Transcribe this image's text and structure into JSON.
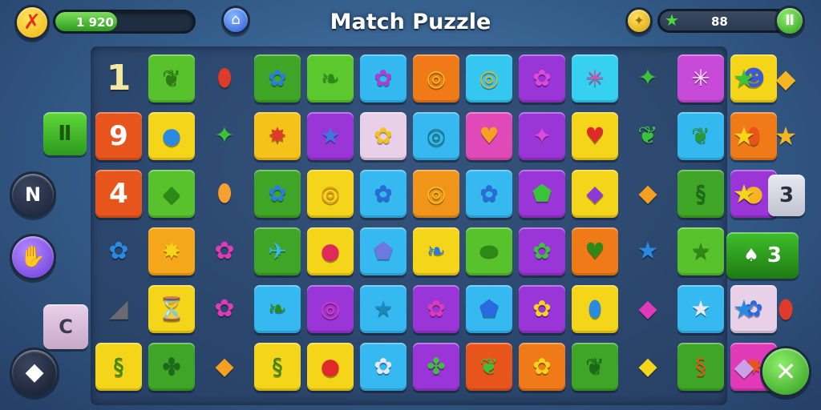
{
  "header": {
    "title": "Match Puzzle",
    "score_value": "1 920",
    "moves_value": "88",
    "progress_fraction": 0.45,
    "moves_fraction": 0.93
  },
  "side_left": {
    "pause_glyph": "Ⅱ",
    "n_glyph": "N",
    "c_glyph": "C"
  },
  "side_right": {
    "three_value": "3",
    "mixed_label": "3"
  },
  "board": {
    "rows": [
      [
        {
          "kind": "plain",
          "glyph": "1",
          "fg": "#f4e7a0"
        },
        {
          "kind": "tile",
          "bg": "#57c22b",
          "glyph": "❦",
          "fg": "#2d7a12"
        },
        {
          "kind": "plain",
          "glyph": "⬮",
          "fg": "#e03a2a"
        },
        {
          "kind": "tile",
          "bg": "#3ea526",
          "glyph": "✿",
          "fg": "#2a7de0"
        },
        {
          "kind": "tile",
          "bg": "#5bc92e",
          "glyph": "❧",
          "fg": "#2a8a16"
        },
        {
          "kind": "tile",
          "bg": "#33b9f0",
          "glyph": "✿",
          "fg": "#b23ad8"
        },
        {
          "kind": "tile",
          "bg": "#f07a18",
          "glyph": "◎",
          "fg": "#f5c020"
        },
        {
          "kind": "tile",
          "bg": "#36c7f0",
          "glyph": "◎",
          "fg": "#e8b520"
        },
        {
          "kind": "tile",
          "bg": "#9a36d8",
          "glyph": "✿",
          "fg": "#e04ad8"
        },
        {
          "kind": "tile",
          "bg": "#36d0f0",
          "glyph": "✳",
          "fg": "#e04aa8"
        },
        {
          "kind": "plain",
          "glyph": "✦",
          "fg": "#3bc23a"
        },
        {
          "kind": "tile",
          "bg": "#c84ad8",
          "glyph": "✳",
          "fg": "#f8e0f8"
        },
        {
          "kind": "tile",
          "bg": "#f5d51a",
          "glyph": "☻",
          "fg": "#3a5ad8"
        }
      ],
      [
        {
          "kind": "tile",
          "bg": "#e8551c",
          "glyph": "9",
          "fg": "#ffffff",
          "num": true
        },
        {
          "kind": "tile",
          "bg": "#f5d51a",
          "glyph": "●",
          "fg": "#2a8ae0"
        },
        {
          "kind": "plain",
          "glyph": "✦",
          "fg": "#3bc23a"
        },
        {
          "kind": "tile",
          "bg": "#f5c21a",
          "glyph": "✸",
          "fg": "#e03a2a"
        },
        {
          "kind": "tile",
          "bg": "#9a36d8",
          "glyph": "★",
          "fg": "#3a7ae0"
        },
        {
          "kind": "tile",
          "bg": "#e8d0e8",
          "glyph": "✿",
          "fg": "#f5c21a"
        },
        {
          "kind": "tile",
          "bg": "#36b9f0",
          "glyph": "◎",
          "fg": "#1a7a8a"
        },
        {
          "kind": "tile",
          "bg": "#e04ab8",
          "glyph": "♥",
          "fg": "#f5a020"
        },
        {
          "kind": "tile",
          "bg": "#9a36d8",
          "glyph": "✦",
          "fg": "#e04ad8"
        },
        {
          "kind": "tile",
          "bg": "#f5d51a",
          "glyph": "♥",
          "fg": "#e02a2a"
        },
        {
          "kind": "plain",
          "glyph": "❦",
          "fg": "#3bc23a"
        },
        {
          "kind": "tile",
          "bg": "#33b9f0",
          "glyph": "❦",
          "fg": "#2a9a2a"
        },
        {
          "kind": "tile",
          "bg": "#f07a18",
          "glyph": "⬮",
          "fg": "#e8551c"
        }
      ],
      [
        {
          "kind": "tile",
          "bg": "#e8551c",
          "glyph": "4",
          "fg": "#ffffff",
          "num": true
        },
        {
          "kind": "tile",
          "bg": "#57c22b",
          "glyph": "◆",
          "fg": "#2d8a16"
        },
        {
          "kind": "plain",
          "glyph": "⬮",
          "fg": "#f5a030"
        },
        {
          "kind": "tile",
          "bg": "#3ea526",
          "glyph": "✿",
          "fg": "#2a7de0"
        },
        {
          "kind": "tile",
          "bg": "#f5d51a",
          "glyph": "◎",
          "fg": "#e8951a"
        },
        {
          "kind": "tile",
          "bg": "#36b9f0",
          "glyph": "✿",
          "fg": "#2a6ae0"
        },
        {
          "kind": "tile",
          "bg": "#f0951a",
          "glyph": "◎",
          "fg": "#f5c020"
        },
        {
          "kind": "tile",
          "bg": "#36b9f0",
          "glyph": "✿",
          "fg": "#2a6ae0"
        },
        {
          "kind": "tile",
          "bg": "#9a36d8",
          "glyph": "⬟",
          "fg": "#3bc23a"
        },
        {
          "kind": "tile",
          "bg": "#f5d51a",
          "glyph": "◆",
          "fg": "#8a3ad8"
        },
        {
          "kind": "plain",
          "glyph": "◆",
          "fg": "#f5a020"
        },
        {
          "kind": "tile",
          "bg": "#3ea526",
          "glyph": "§",
          "fg": "#1a6a1a"
        },
        {
          "kind": "tile",
          "bg": "#9a36d8",
          "glyph": "●",
          "fg": "#f5b520"
        }
      ],
      [
        {
          "kind": "plain",
          "glyph": "✿",
          "fg": "#2a8ae0"
        },
        {
          "kind": "tile",
          "bg": "#f5a61a",
          "glyph": "✸",
          "fg": "#f5d51a"
        },
        {
          "kind": "plain",
          "glyph": "✿",
          "fg": "#e03ab8"
        },
        {
          "kind": "tile",
          "bg": "#3ea526",
          "glyph": "✈",
          "fg": "#36b9f0"
        },
        {
          "kind": "tile",
          "bg": "#f5d51a",
          "glyph": "●",
          "fg": "#e02a5a"
        },
        {
          "kind": "tile",
          "bg": "#36b9f0",
          "glyph": "⬟",
          "fg": "#6a7ae0"
        },
        {
          "kind": "tile",
          "bg": "#f5d51a",
          "glyph": "❧",
          "fg": "#2a7ae0"
        },
        {
          "kind": "tile",
          "bg": "#57c22b",
          "glyph": "⬬",
          "fg": "#2d8a16"
        },
        {
          "kind": "tile",
          "bg": "#9a36d8",
          "glyph": "✿",
          "fg": "#3bc23a"
        },
        {
          "kind": "tile",
          "bg": "#f07a18",
          "glyph": "♥",
          "fg": "#2d8a16"
        },
        {
          "kind": "plain",
          "glyph": "★",
          "fg": "#2a8ae0"
        },
        {
          "kind": "tile",
          "bg": "#57c22b",
          "glyph": "★",
          "fg": "#2d8a16"
        },
        {
          "kind": "plain",
          "glyph": "★",
          "fg": "#f5b520"
        }
      ],
      [
        {
          "kind": "plain",
          "glyph": "◢",
          "fg": "#6a6a70"
        },
        {
          "kind": "tile",
          "bg": "#f5d51a",
          "glyph": "⏳",
          "fg": "#c84ad8"
        },
        {
          "kind": "plain",
          "glyph": "✿",
          "fg": "#e03ab8"
        },
        {
          "kind": "tile",
          "bg": "#36b9f0",
          "glyph": "❧",
          "fg": "#2d8a16"
        },
        {
          "kind": "tile",
          "bg": "#9a36d8",
          "glyph": "◎",
          "fg": "#e03ab8"
        },
        {
          "kind": "tile",
          "bg": "#36b9f0",
          "glyph": "★",
          "fg": "#1a8ab8"
        },
        {
          "kind": "tile",
          "bg": "#9a36d8",
          "glyph": "✿",
          "fg": "#e03ab8"
        },
        {
          "kind": "tile",
          "bg": "#36b9f0",
          "glyph": "⬟",
          "fg": "#2a6ae0"
        },
        {
          "kind": "tile",
          "bg": "#9a36d8",
          "glyph": "✿",
          "fg": "#f5d51a"
        },
        {
          "kind": "tile",
          "bg": "#f5d51a",
          "glyph": "⬮",
          "fg": "#2a8ae0"
        },
        {
          "kind": "plain",
          "glyph": "◆",
          "fg": "#e03ab8"
        },
        {
          "kind": "tile",
          "bg": "#36b9f0",
          "glyph": "★",
          "fg": "#e8e8f0"
        },
        {
          "kind": "tile",
          "bg": "#e8d0e8",
          "glyph": "✿",
          "fg": "#2a6ae0"
        }
      ],
      [
        {
          "kind": "tile",
          "bg": "#f5d51a",
          "glyph": "§",
          "fg": "#2d8a16"
        },
        {
          "kind": "tile",
          "bg": "#3ea526",
          "glyph": "✤",
          "fg": "#1a6a1a"
        },
        {
          "kind": "plain",
          "glyph": "◆",
          "fg": "#f5a020"
        },
        {
          "kind": "tile",
          "bg": "#f5d51a",
          "glyph": "§",
          "fg": "#2d8a16"
        },
        {
          "kind": "tile",
          "bg": "#f5d51a",
          "glyph": "●",
          "fg": "#e02a2a"
        },
        {
          "kind": "tile",
          "bg": "#36b9f0",
          "glyph": "✿",
          "fg": "#e8e8f0"
        },
        {
          "kind": "tile",
          "bg": "#9a36d8",
          "glyph": "✤",
          "fg": "#3bc23a"
        },
        {
          "kind": "tile",
          "bg": "#e8551c",
          "glyph": "❦",
          "fg": "#3bc23a"
        },
        {
          "kind": "tile",
          "bg": "#f07a18",
          "glyph": "✿",
          "fg": "#f5d51a"
        },
        {
          "kind": "tile",
          "bg": "#3ea526",
          "glyph": "❦",
          "fg": "#1a6a1a"
        },
        {
          "kind": "plain",
          "glyph": "◆",
          "fg": "#f5d51a"
        },
        {
          "kind": "tile",
          "bg": "#3ea526",
          "glyph": "§",
          "fg": "#e8551c"
        },
        {
          "kind": "tile",
          "bg": "#e03ab8",
          "glyph": "✸",
          "fg": "#e8551c"
        }
      ]
    ]
  },
  "right_column": [
    {
      "glyph": "★",
      "fg": "#3bc23a"
    },
    {
      "glyph": "★",
      "fg": "#f5d51a"
    },
    {
      "glyph": "★",
      "fg": "#f5d51a"
    },
    {
      "glyph": "",
      "fg": "#ffffff"
    },
    {
      "glyph": "★",
      "fg": "#2a8ae0"
    },
    {
      "glyph": "◆",
      "fg": "#c8a0e8"
    }
  ],
  "right_column2": [
    {
      "glyph": "◆",
      "fg": "#f5b520"
    },
    {
      "glyph": "★",
      "fg": "#f5b520"
    },
    {
      "glyph": "",
      "fg": "#ffffff"
    },
    {
      "glyph": "",
      "fg": "#ffffff"
    },
    {
      "glyph": "⬮",
      "fg": "#e03a2a"
    },
    {
      "glyph": "",
      "fg": "#ffffff"
    }
  ],
  "colors": {
    "accent_green": "#3fbf2a",
    "accent_yellow": "#f5d51a",
    "frame_dark": "#1c2a3e"
  }
}
